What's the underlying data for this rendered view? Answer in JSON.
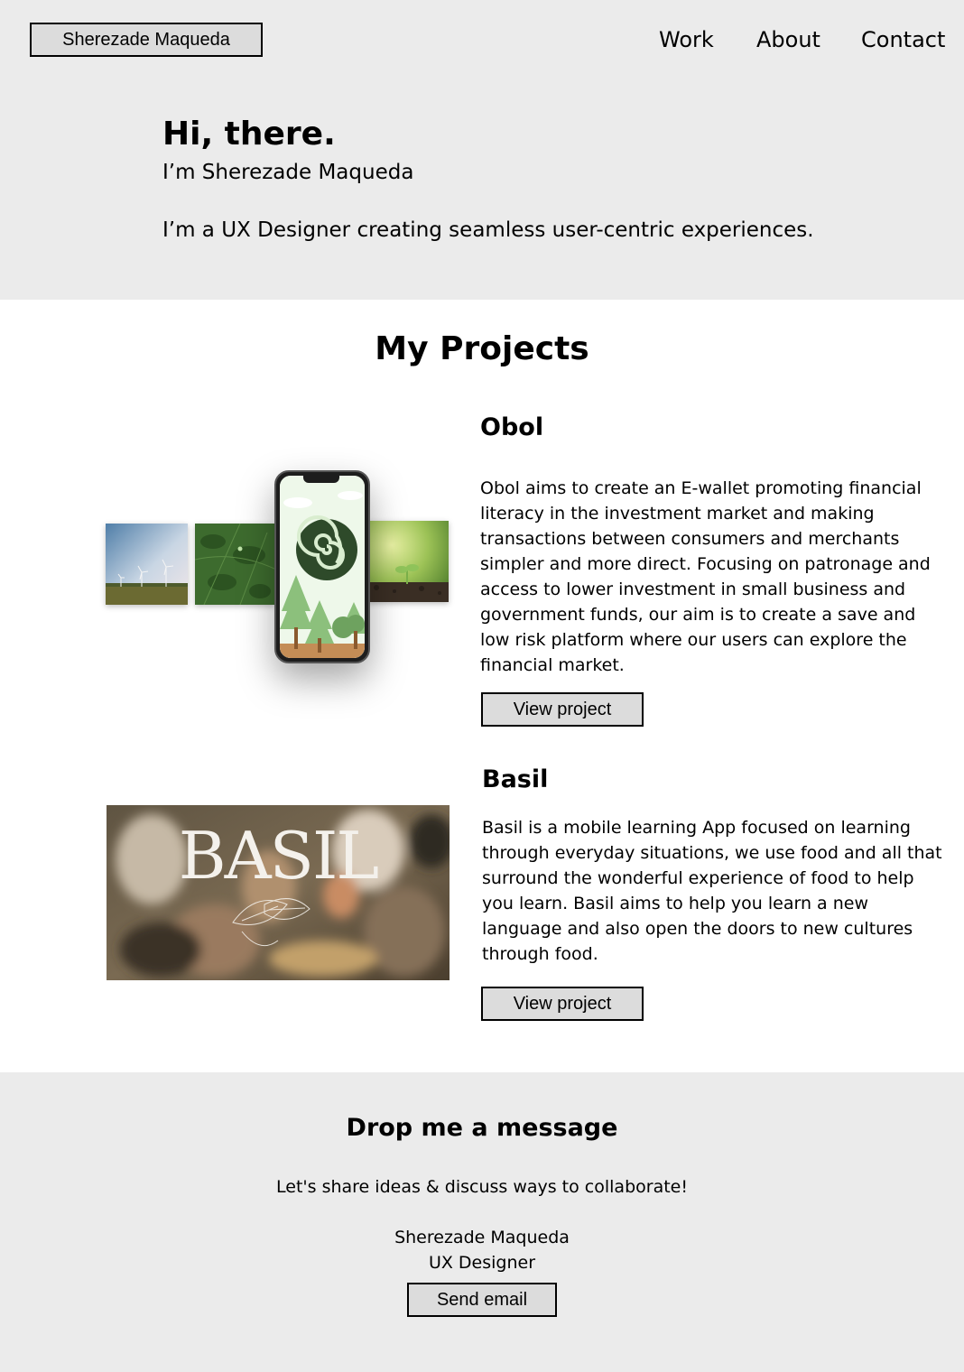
{
  "header": {
    "logo_label": "Sherezade Maqueda",
    "nav": [
      {
        "label": "Work"
      },
      {
        "label": "About"
      },
      {
        "label": "Contact"
      }
    ]
  },
  "hero": {
    "greeting": "Hi, there.",
    "name_line": "I’m Sherezade Maqueda",
    "tagline": "I’m a UX Designer creating seamless user-centric experiences."
  },
  "projects": {
    "title": "My Projects",
    "items": [
      {
        "name": "Obol",
        "description": "Obol aims to create an E-wallet promoting financial literacy in the investment market and making transactions between consumers and merchants simpler and more direct. Focusing on patronage and access to lower investment in small business and government funds, our aim is to create a save and low risk platform where our users can explore the financial market.",
        "button_label": "View project"
      },
      {
        "name": "Basil",
        "description": "Basil is a mobile learning App focused on learning through everyday situations, we use food and all that surround the wonderful experience of food to help you learn. Basil aims to help you learn a new language and also open the doors to new cultures through food.",
        "button_label": "View project",
        "image_logo_text": "BASIL"
      }
    ]
  },
  "contact": {
    "title": "Drop me a message",
    "subtitle": "Let's share ideas & discuss ways to collaborate!",
    "name": "Sherezade Maqueda",
    "role": "UX Designer",
    "button_label": "Send email"
  },
  "colors": {
    "section_bg": "#ebebeb",
    "button_bg": "#dcdcdc",
    "obol_green": "#2e4a2a"
  }
}
